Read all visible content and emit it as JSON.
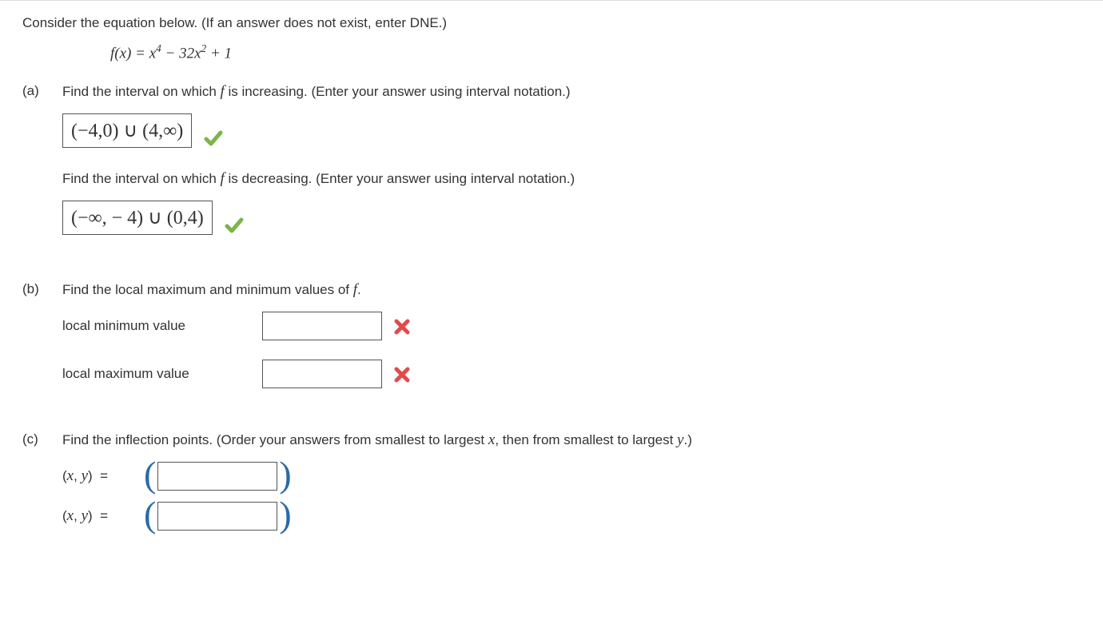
{
  "intro": "Consider the equation below. (If an answer does not exist, enter DNE.)",
  "equation_html": "f(x) = x<sup>4</sup> − 32x<sup>2</sup> + 1",
  "parts": {
    "a": {
      "label": "(a)",
      "prompt1_pre": "Find the interval on which ",
      "prompt1_post": " is increasing. (Enter your answer using interval notation.)",
      "answer1": "(−4,0) ∪ (4,∞)",
      "prompt2_pre": "Find the interval on which ",
      "prompt2_post": " is decreasing. (Enter your answer using interval notation.)",
      "answer2": "(−∞, − 4) ∪ (0,4)"
    },
    "b": {
      "label": "(b)",
      "prompt_pre": "Find the local maximum and minimum values of ",
      "prompt_post": ".",
      "min_label": "local minimum value",
      "min_value": "",
      "max_label": "local maximum value",
      "max_value": ""
    },
    "c": {
      "label": "(c)",
      "prompt": "Find the inflection points. (Order your answers from smallest to largest x, then from smallest to largest y.)",
      "xy_label": "(x, y)  =",
      "point1": "",
      "point2": ""
    }
  },
  "f_symbol": "f"
}
